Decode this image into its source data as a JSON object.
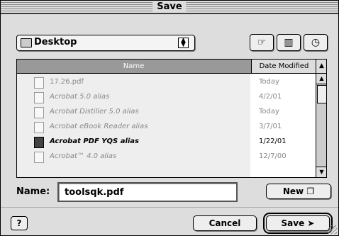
{
  "dialog": {
    "title": "Save"
  },
  "location": {
    "label": "Desktop"
  },
  "toolbar": {
    "desktop_icon": "pointer-hand-icon",
    "shortcuts_icon": "book-icon",
    "recent_icon": "clock-icon"
  },
  "list": {
    "headers": {
      "name": "Name",
      "date": "Date Modified"
    },
    "rows": [
      {
        "name": "17.26.pdf",
        "date": "Today"
      },
      {
        "name": "Acrobat 5.0 alias",
        "date": "4/2/01"
      },
      {
        "name": "Acrobat Distiller 5.0 alias",
        "date": "Today"
      },
      {
        "name": "Acrobat eBook Reader alias",
        "date": "3/7/01"
      },
      {
        "name": "Acrobat PDF YQS alias",
        "date": "1/22/01"
      },
      {
        "name": "Acrobat™ 4.0 alias",
        "date": "12/7/00"
      }
    ]
  },
  "name_field": {
    "label": "Name:",
    "value": "toolsqk.pdf"
  },
  "buttons": {
    "new": "New",
    "cancel": "Cancel",
    "save": "Save",
    "help": "?"
  }
}
